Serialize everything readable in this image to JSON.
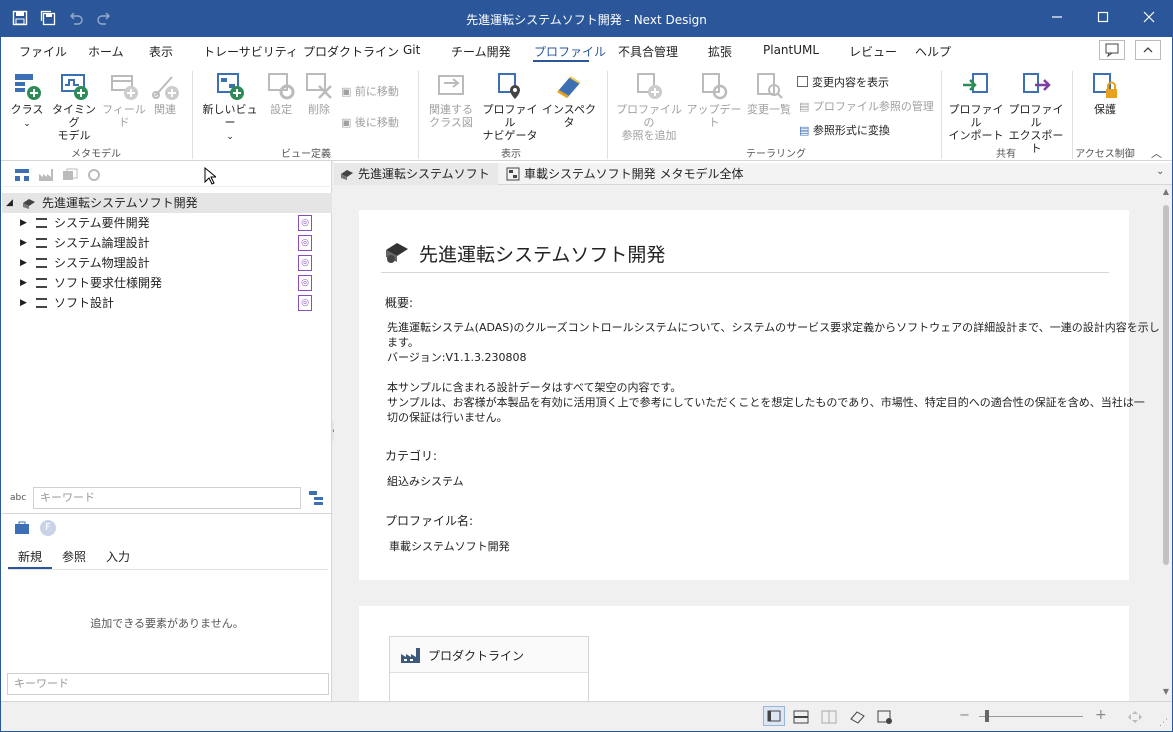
{
  "window": {
    "title": "先進運転システムソフト開発 - Next Design"
  },
  "tabs": [
    "ファイル",
    "ホーム",
    "表示",
    "トレーサビリティ",
    "プロダクトライン",
    "Git",
    "チーム開発",
    "プロファイル",
    "不具合管理",
    "拡張",
    "PlantUML",
    "レビュー",
    "ヘルプ"
  ],
  "active_tab": "プロファイル",
  "ribbon": {
    "metamodel": {
      "group": "メタモデル",
      "class": "クラス",
      "timing_model": "タイミング\nモデル",
      "field": "フィールド",
      "relation": "関連"
    },
    "view_def": {
      "group": "ビュー定義",
      "new_view": "新しいビュー",
      "settings": "設定",
      "delete": "削除",
      "move_forward": "前に移動",
      "move_backward": "後に移動"
    },
    "display": {
      "group": "表示",
      "related_class_diagram": "関連する\nクラス図",
      "profile_navigator": "プロファイル\nナビゲータ",
      "inspector": "インスペクタ"
    },
    "tailoring": {
      "group": "テーラリング",
      "add_profile_reference": "プロファイルの\n参照を追加",
      "update": "アップデート",
      "change_list": "変更一覧",
      "show_changes": "変更内容を表示",
      "manage_profile_references": "プロファイル参照の管理",
      "convert_to_reference": "参照形式に変換"
    },
    "share": {
      "group": "共有",
      "profile_import": "プロファイル\nインポート",
      "profile_export": "プロファイル\nエクスポート"
    },
    "access": {
      "group": "アクセス制御",
      "protect": "保護"
    }
  },
  "tree": {
    "root": "先進運転システムソフト開発",
    "items": [
      "システム要件開発",
      "システム論理設計",
      "システム物理設計",
      "ソフト要求仕様開発",
      "ソフト設計"
    ],
    "keyword_placeholder": "キーワード"
  },
  "lower_pane": {
    "tabs": [
      "新規",
      "参照",
      "入力"
    ],
    "empty_message": "追加できる要素がありません。",
    "keyword_placeholder": "キーワード"
  },
  "doc_tabs": [
    "先進運転システムソフト開発",
    "車載システムソフト開発 メタモデル全体概要"
  ],
  "document": {
    "title": "先進運転システムソフト開発",
    "overview_label": "概要:",
    "overview_line1": "先進運転システム(ADAS)のクルーズコントロールシステムについて、システムのサービス要求定義からソフトウェアの詳細設計まで、一連の設計内容を示し",
    "overview_line2": "ます。",
    "version": "バージョン:V1.1.3.230808",
    "note_line1": "本サンプルに含まれる設計データはすべて架空の内容です。",
    "note_line2": "サンプルは、お客様が本製品を有効に活用頂く上で参考にしていただくことを想定したものであり、市場性、特定目的への適合性の保証を含め、当社は一",
    "note_line3": "切の保証は行いません。",
    "category_label": "カテゴリ:",
    "category_value": "組込みシステム",
    "profile_label": "プロファイル名:",
    "profile_value": "車載システムソフト開発",
    "product_line_card": "プロダクトライン"
  },
  "status": {
    "zoom_minus": "−",
    "zoom_plus": "+"
  }
}
